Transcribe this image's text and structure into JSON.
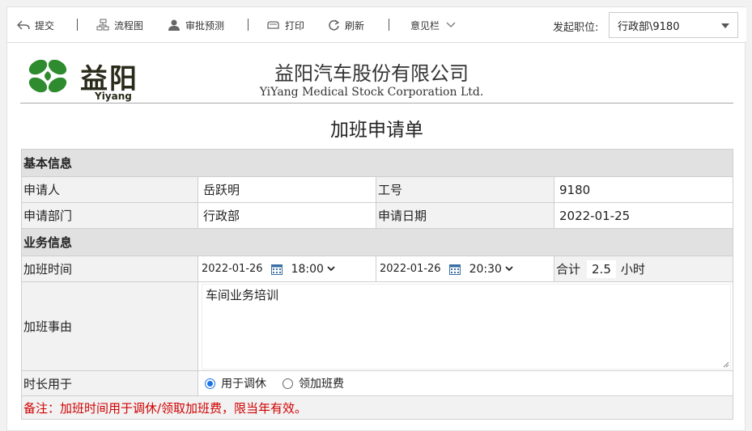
{
  "toolbar": {
    "submit": "提交",
    "flowchart": "流程图",
    "approval_forecast": "审批预测",
    "print": "打印",
    "refresh": "刷新",
    "opinion": "意见栏",
    "post_label": "发起职位:",
    "post_value": "行政部\\9180"
  },
  "header": {
    "logo_text": "益阳",
    "logo_sub": "Yiyang",
    "company_name": "益阳汽车股份有限公司",
    "company_en": "YiYang Medical Stock Corporation Ltd.",
    "form_title": "加班申请单"
  },
  "basic": {
    "section": "基本信息",
    "applicant_label": "申请人",
    "applicant_value": "岳跃明",
    "empno_label": "工号",
    "empno_value": "9180",
    "dept_label": "申请部门",
    "dept_value": "行政部",
    "date_label": "申请日期",
    "date_value": "2022-01-25"
  },
  "business": {
    "section": "业务信息",
    "time_label": "加班时间",
    "start_date": "2022-01-26",
    "start_time": "18:00",
    "end_date": "2022-01-26",
    "end_time": "20:30",
    "total_label": "合计",
    "total_value": "2.5",
    "total_unit": "小时",
    "reason_label": "加班事由",
    "reason_value": "车间业务培训",
    "usage_label": "时长用于",
    "usage_option_1": "用于调休",
    "usage_option_2": "领加班费",
    "usage_selected": "用于调休",
    "note": "备注：加班时间用于调休/领取加班费，限当年有效。"
  },
  "colors": {
    "note": "#d00000",
    "section_bg": "#e1e1e1",
    "radio_accent": "#1a73e8"
  }
}
